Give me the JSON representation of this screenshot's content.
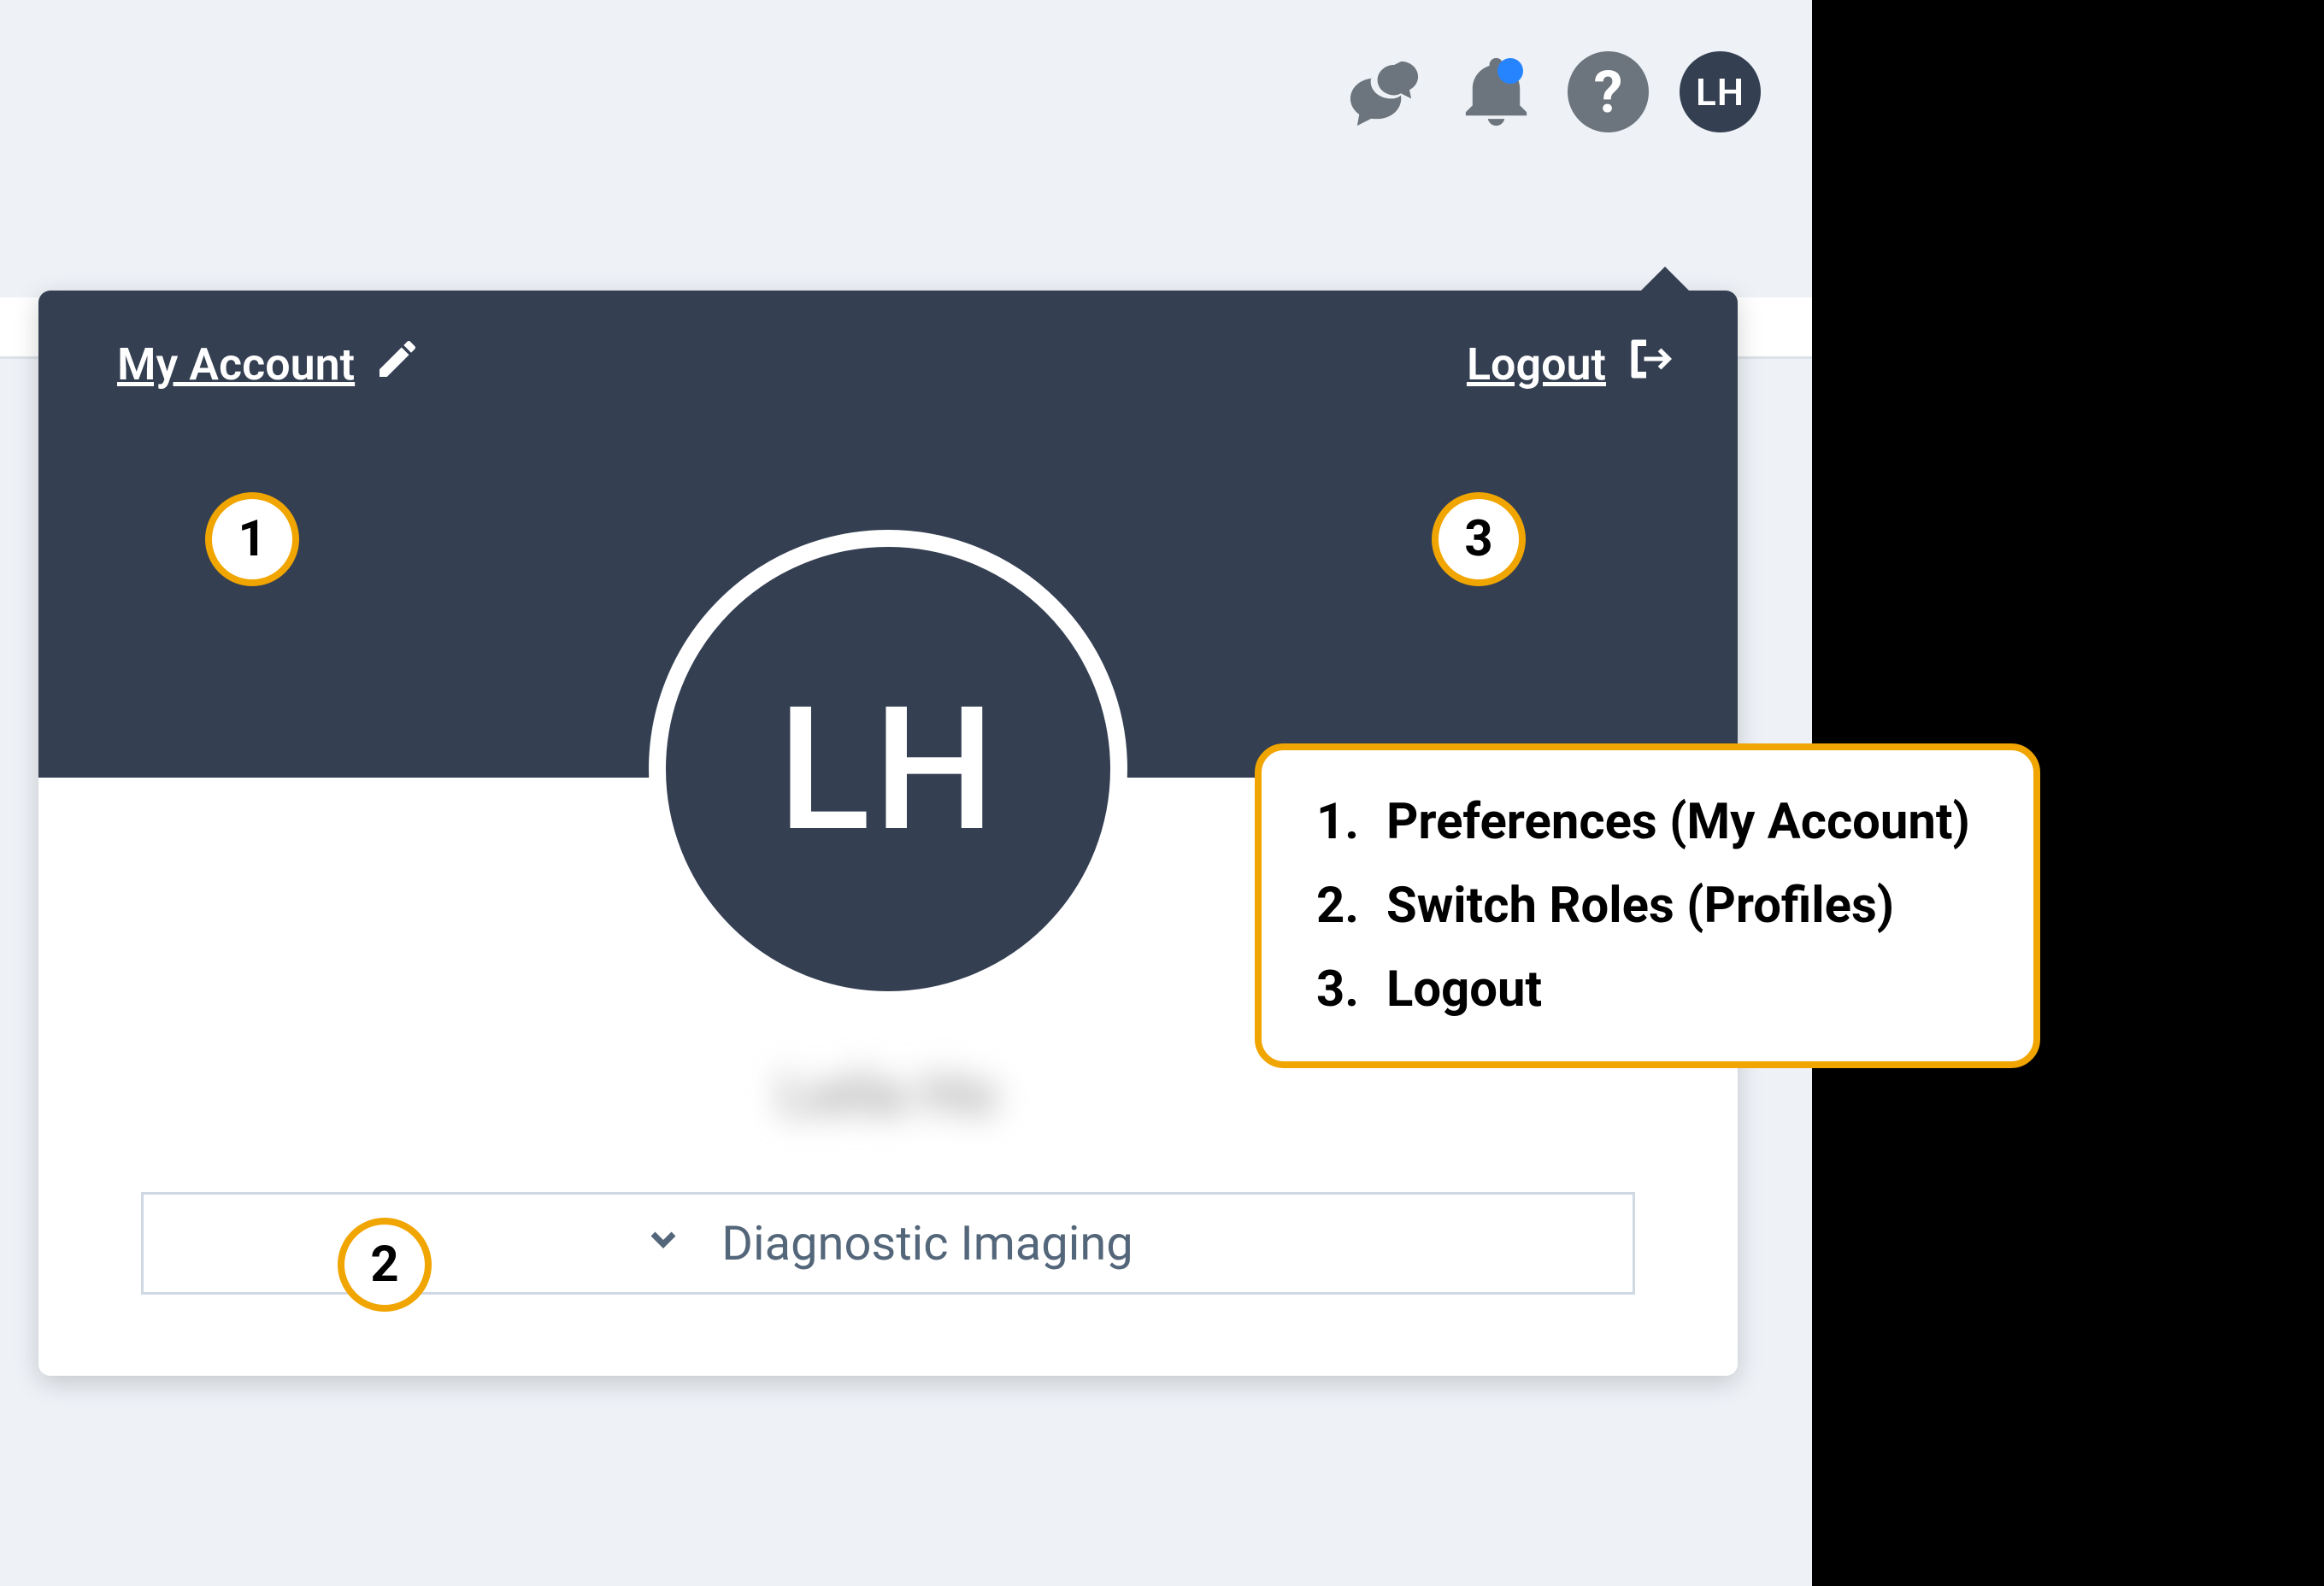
{
  "topbar": {
    "avatar_initials": "LH",
    "help_symbol": "?"
  },
  "dropdown": {
    "my_account_label": "My Account",
    "logout_label": "Logout",
    "avatar_initials": "LH",
    "user_name_blurred": "Leila Ho",
    "role_selected": "Diagnostic Imaging"
  },
  "callouts": {
    "badge1": "1",
    "badge2": "2",
    "badge3": "3"
  },
  "legend": {
    "items": [
      {
        "num": "1.",
        "text": "Preferences (My Account)"
      },
      {
        "num": "2.",
        "text": "Switch Roles (Profiles)"
      },
      {
        "num": "3.",
        "text": "Logout"
      }
    ]
  }
}
